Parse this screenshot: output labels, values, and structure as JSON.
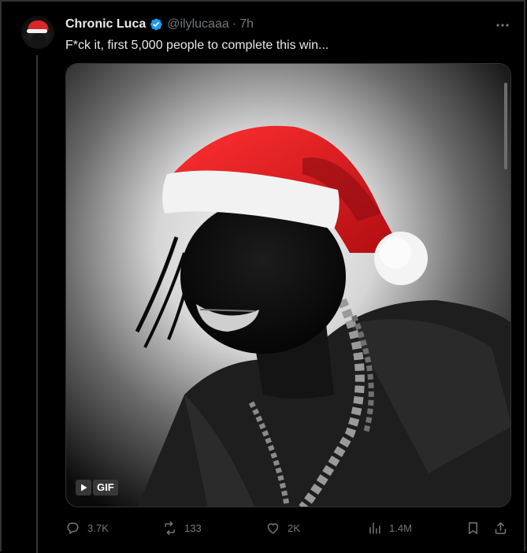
{
  "post": {
    "author_name": "Chronic Luca",
    "handle": "@ilylucaaa",
    "separator": "·",
    "time": "7h",
    "text": "F*ck it, first 5,000 people to complete this win...",
    "media": {
      "type": "gif",
      "badge_label": "GIF"
    }
  },
  "actions": {
    "replies": "3.7K",
    "reposts": "133",
    "likes": "2K",
    "views": "1.4M"
  },
  "icons": {
    "more": "more-horizontal-icon",
    "verified": "verified-badge-icon",
    "reply": "reply-icon",
    "repost": "repost-icon",
    "like": "heart-icon",
    "views": "analytics-icon",
    "bookmark": "bookmark-icon",
    "share": "share-icon",
    "play": "play-icon"
  },
  "colors": {
    "background": "#000000",
    "text": "#e7e9ea",
    "muted": "#71767b",
    "verified": "#1d9bf0",
    "hat_red": "#d8262a"
  }
}
